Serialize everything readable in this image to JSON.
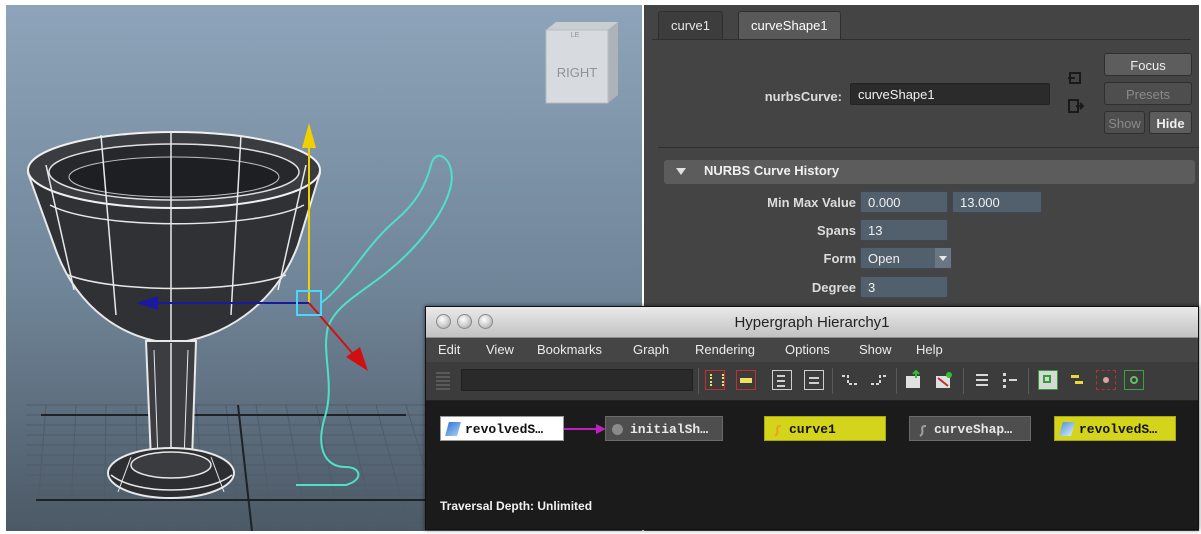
{
  "viewport": {
    "view_cube_label": "RIGHT",
    "view_cube_corner": "LE"
  },
  "attribute_editor": {
    "tabs": [
      {
        "label": "curve1",
        "active": false
      },
      {
        "label": "curveShape1",
        "active": true
      }
    ],
    "node_type_label": "nurbsCurve:",
    "node_name_value": "curveShape1",
    "buttons": {
      "focus": "Focus",
      "presets": "Presets",
      "show": "Show",
      "hide": "Hide"
    },
    "section": {
      "title": "NURBS Curve History",
      "expanded": true,
      "rows": {
        "min_max_label": "Min Max Value",
        "min_value": "0.000",
        "max_value": "13.000",
        "spans_label": "Spans",
        "spans_value": "13",
        "form_label": "Form",
        "form_value": "Open",
        "degree_label": "Degree",
        "degree_value": "3"
      }
    }
  },
  "hypergraph": {
    "title": "Hypergraph Hierarchy1",
    "menu": [
      "Edit",
      "View",
      "Bookmarks",
      "Graph",
      "Rendering",
      "Options",
      "Show",
      "Help"
    ],
    "search_value": "",
    "nodes": [
      {
        "label": "revolvedS…",
        "style": "white"
      },
      {
        "label": "initialSh…",
        "style": "gray"
      },
      {
        "label": "curve1",
        "style": "yellow"
      },
      {
        "label": "curveShap…",
        "style": "gray"
      },
      {
        "label": "revolvedS…",
        "style": "yellow"
      }
    ],
    "connection_color": "#c020c0",
    "status": "Traversal Depth: Unlimited"
  },
  "colors": {
    "curve": "#4fe0c8",
    "axis_y": "#f0d000",
    "axis_x": "#1a1aa0",
    "axis_z": "#d01010",
    "selection_yellow": "#d4d41a"
  }
}
